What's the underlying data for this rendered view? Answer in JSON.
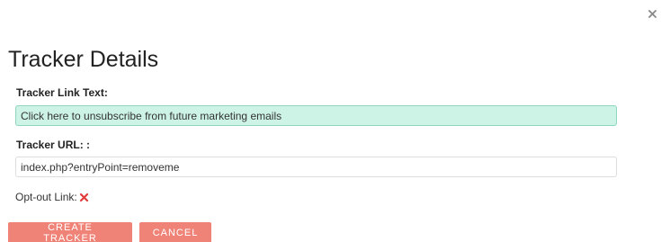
{
  "dialog": {
    "title": "Tracker Details",
    "close_icon": "close-icon"
  },
  "form": {
    "link_text_label": "Tracker Link Text:",
    "link_text_value": "Click here to unsubscribe from future marketing emails",
    "url_label": "Tracker URL: :",
    "url_value": "index.php?entryPoint=removeme",
    "optout_label": "Opt-out Link:",
    "optout_icon": "x-mark-icon"
  },
  "buttons": {
    "create": "CREATE TRACKER",
    "cancel": "CANCEL"
  },
  "colors": {
    "accent_button": "#f08377",
    "active_field_bg": "#cdf3e7",
    "active_field_border": "#8fd6bd",
    "optout_mark": "#e23b3b"
  }
}
